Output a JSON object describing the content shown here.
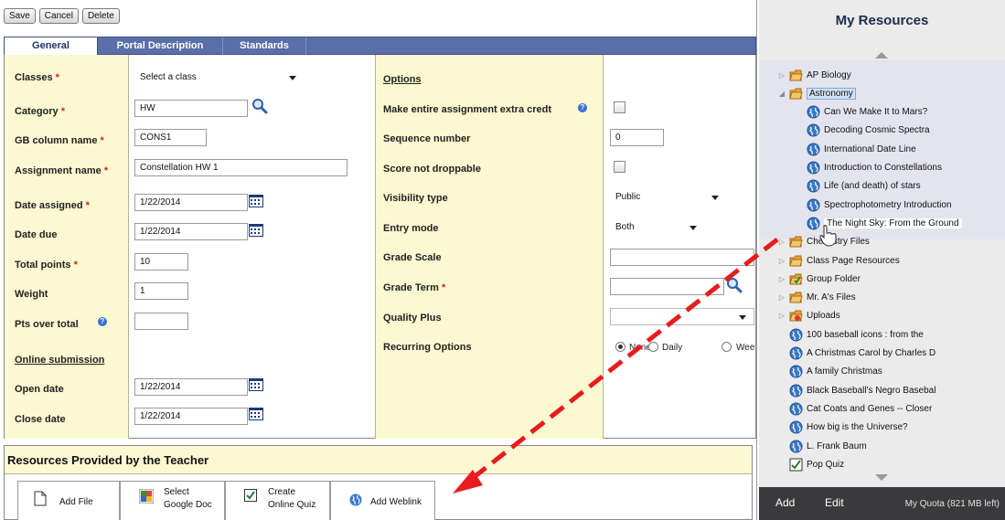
{
  "toolbar": {
    "save": "Save",
    "cancel": "Cancel",
    "delete": "Delete"
  },
  "tabs": [
    "General",
    "Portal Description",
    "Standards"
  ],
  "form": {
    "classes": {
      "label": "Classes",
      "value": "Select a class"
    },
    "category": {
      "label": "Category",
      "value": "HW"
    },
    "gb_column": {
      "label": "GB column name",
      "value": "CONS1"
    },
    "assignment_name": {
      "label": "Assignment name",
      "value": "Constellation HW 1"
    },
    "date_assigned": {
      "label": "Date assigned",
      "value": "1/22/2014"
    },
    "date_due": {
      "label": "Date due",
      "value": "1/22/2014"
    },
    "total_points": {
      "label": "Total points",
      "value": "10"
    },
    "weight": {
      "label": "Weight",
      "value": "1"
    },
    "pts_over_total": {
      "label": "Pts over total",
      "value": ""
    },
    "online_submission": {
      "label": "Online submission"
    },
    "open_date": {
      "label": "Open date",
      "value": "1/22/2014"
    },
    "close_date": {
      "label": "Close date",
      "value": "1/22/2014"
    },
    "options": {
      "label": "Options"
    },
    "extra_credit": {
      "label": "Make entire assignment extra credt",
      "checked": false
    },
    "sequence": {
      "label": "Sequence number",
      "value": "0"
    },
    "score_not_droppable": {
      "label": "Score not droppable",
      "checked": false
    },
    "visibility": {
      "label": "Visibility type",
      "value": "Public"
    },
    "entry_mode": {
      "label": "Entry mode",
      "value": "Both"
    },
    "grade_scale": {
      "label": "Grade Scale",
      "value": ""
    },
    "grade_term": {
      "label": "Grade Term",
      "value": ""
    },
    "quality_plus": {
      "label": "Quality Plus",
      "value": ""
    },
    "recurring": {
      "label": "Recurring Options",
      "options": [
        "None",
        "Daily",
        "Wee"
      ],
      "selected": "None"
    },
    "required_mark": "*"
  },
  "resources": {
    "header": "Resources Provided by the Teacher",
    "add_file": "Add File",
    "google_doc_1": "Select",
    "google_doc_2": "Google Doc",
    "quiz_1": "Create",
    "quiz_2": "Online Quiz",
    "weblink": "Add Weblink"
  },
  "panel": {
    "title": "My Resources",
    "tree": [
      {
        "label": "AP Biology",
        "type": "folder",
        "level": 0,
        "twisty": "▷"
      },
      {
        "label": "Astronomy",
        "type": "folder",
        "level": 0,
        "twisty": "◢",
        "selected": true
      },
      {
        "label": "Can We Make It to Mars?",
        "type": "web",
        "level": 1
      },
      {
        "label": "Decoding Cosmic Spectra",
        "type": "web",
        "level": 1
      },
      {
        "label": "International Date Line",
        "type": "web",
        "level": 1
      },
      {
        "label": "Introduction to Constellations",
        "type": "web",
        "level": 1
      },
      {
        "label": "Life (and death) of stars",
        "type": "web",
        "level": 1
      },
      {
        "label": "Spectrophotometry Introduction",
        "type": "web",
        "level": 1
      },
      {
        "label": "The Night Sky: From the Ground",
        "type": "web",
        "level": 1,
        "hover": true
      },
      {
        "label": "Chemistry Files",
        "type": "folder",
        "level": 0,
        "twisty": "▷"
      },
      {
        "label": "Class Page Resources",
        "type": "folder",
        "level": 0,
        "twisty": "▷"
      },
      {
        "label": "Group Folder",
        "type": "folder-check",
        "level": 0,
        "twisty": "▷"
      },
      {
        "label": "Mr. A's Files",
        "type": "folder",
        "level": 0,
        "twisty": "▷"
      },
      {
        "label": "Uploads",
        "type": "folder-red",
        "level": 0,
        "twisty": "▷"
      },
      {
        "label": "100 baseball icons : from the",
        "type": "web",
        "level": 0
      },
      {
        "label": "A Christmas Carol by Charles D",
        "type": "web",
        "level": 0
      },
      {
        "label": "A family Christmas",
        "type": "web",
        "level": 0
      },
      {
        "label": "Black Baseball's Negro Basebal",
        "type": "web",
        "level": 0
      },
      {
        "label": "Cat Coats and Genes -- Closer",
        "type": "web",
        "level": 0
      },
      {
        "label": "How big is the Universe?",
        "type": "web",
        "level": 0
      },
      {
        "label": "L. Frank Baum",
        "type": "web",
        "level": 0
      },
      {
        "label": "Pop Quiz",
        "type": "quiz",
        "level": 0
      }
    ],
    "add": "Add",
    "edit": "Edit",
    "quota": "My Quota (821 MB left)"
  }
}
